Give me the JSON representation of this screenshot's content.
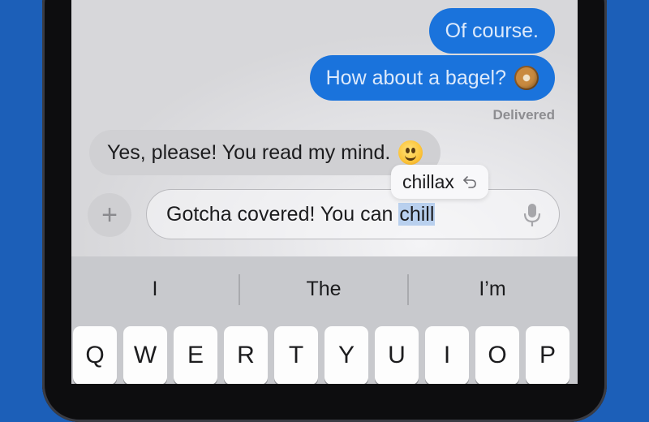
{
  "conversation": {
    "messages": [
      {
        "direction": "sent",
        "text": "Of course.",
        "emoji": null
      },
      {
        "direction": "sent",
        "text": "How about a bagel?",
        "emoji": "bagel-emoji"
      },
      {
        "direction": "received",
        "text": "Yes, please! You read my mind.",
        "emoji": "smiling-face-emoji"
      }
    ],
    "delivery_status": "Delivered"
  },
  "composer": {
    "text_before": "Gotcha covered! You can ",
    "highlighted_word": "chill",
    "add_icon": "plus-icon",
    "mic_icon": "microphone-icon"
  },
  "autocorrect": {
    "suggestion": "chillax",
    "icon": "undo-icon"
  },
  "keyboard": {
    "predictions": [
      "I",
      "The",
      "I’m"
    ],
    "row1": [
      "Q",
      "W",
      "E",
      "R",
      "T",
      "Y",
      "U",
      "I",
      "O",
      "P"
    ]
  },
  "colors": {
    "background": "#1c5fb8",
    "sent_bubble": "#1a73dc",
    "received_bubble": "#d0d0d3",
    "selection": "#b9d0ee"
  }
}
